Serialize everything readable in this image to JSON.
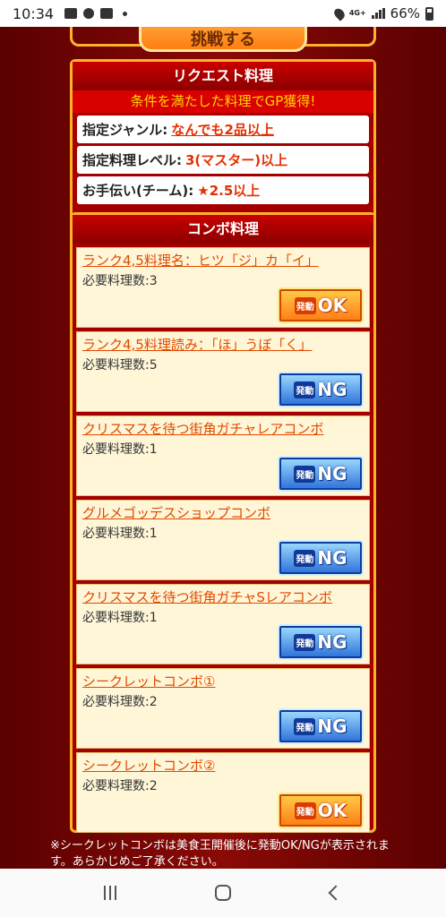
{
  "status_bar": {
    "time": "10:34",
    "network": "4G+",
    "battery": "66%"
  },
  "top_button": {
    "label": "挑戦する"
  },
  "request": {
    "title": "リクエスト料理",
    "subtitle": "条件を満たした料理でGP獲得!",
    "rows": [
      {
        "label": "指定ジャンル:",
        "value": "なんでも2品以上"
      },
      {
        "label": "指定料理レベル:",
        "value": "3(マスター)以上"
      },
      {
        "label": "お手伝い(チーム):",
        "value": "★2.5以上"
      }
    ]
  },
  "combo": {
    "title": "コンボ料理",
    "req_prefix": "必要料理数:",
    "badge_small": "発動",
    "items": [
      {
        "name": "ランク4,5料理名：ヒツ「ジ」カ「イ」",
        "req": "必要料理数:3",
        "status": "OK"
      },
      {
        "name": "ランク4,5料理読み：「ほ」うぼ「く」",
        "req": "必要料理数:5",
        "status": "NG"
      },
      {
        "name": "クリスマスを待つ街角ガチャレアコンボ",
        "req": "必要料理数:1",
        "status": "NG"
      },
      {
        "name": "グルメゴッデスショップコンボ",
        "req": "必要料理数:1",
        "status": "NG"
      },
      {
        "name": "クリスマスを待つ街角ガチャSレアコンボ",
        "req": "必要料理数:1",
        "status": "NG"
      },
      {
        "name": "シークレットコンボ①",
        "req": "必要料理数:2",
        "status": "NG"
      },
      {
        "name": "シークレットコンボ②",
        "req": "必要料理数:2",
        "status": "OK"
      }
    ]
  },
  "note": "※シークレットコンボは美食王開催後に発動OK/NGが表示されます。あらかじめご了承ください。",
  "colors": {
    "panel_border": "#ffb12b",
    "panel_bg": "#a40000",
    "accent_orange": "#e04a00",
    "ok": "#ff7a14",
    "ng": "#2a6fd8"
  }
}
